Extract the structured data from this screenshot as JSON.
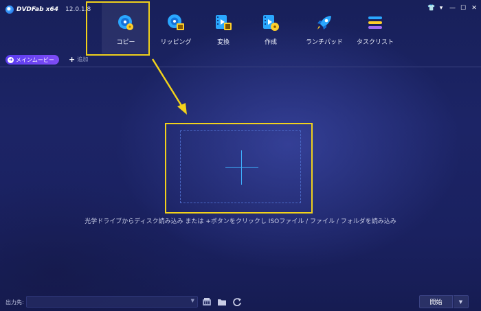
{
  "app": {
    "brand": "DVDFab x64",
    "version": "12.0.1.8"
  },
  "window_controls": [
    {
      "name": "skin-icon",
      "glyph": "👕"
    },
    {
      "name": "menu-icon",
      "glyph": "▾"
    },
    {
      "name": "minimize-icon",
      "glyph": "—"
    },
    {
      "name": "maximize-icon",
      "glyph": "☐"
    },
    {
      "name": "close-icon",
      "glyph": "✕"
    }
  ],
  "nav": {
    "items": [
      {
        "label": "コピー",
        "icon": "disc-copy-icon",
        "active": true
      },
      {
        "label": "リッピング",
        "icon": "disc-ripping-icon",
        "active": false
      },
      {
        "label": "変換",
        "icon": "film-convert-icon",
        "active": false
      },
      {
        "label": "作成",
        "icon": "film-disc-create-icon",
        "active": false
      },
      {
        "label": "ランチパッド",
        "icon": "rocket-icon",
        "active": false
      },
      {
        "label": "タスクリスト",
        "icon": "task-list-icon",
        "active": false
      }
    ]
  },
  "tabs": {
    "main_label": "メインムービー",
    "add_label": "追加"
  },
  "drop_zone": {
    "hint": "光学ドライブからディスク読み込み または +ボタンをクリックし ISOファイル / ファイル / フォルダを読み込み"
  },
  "bottom": {
    "output_label": "出力先:",
    "output_value": "",
    "start_label": "開始"
  },
  "colors": {
    "highlight": "#f2d21b",
    "accent": "#3fb2ff",
    "tab_pill": "#6a45f2"
  }
}
